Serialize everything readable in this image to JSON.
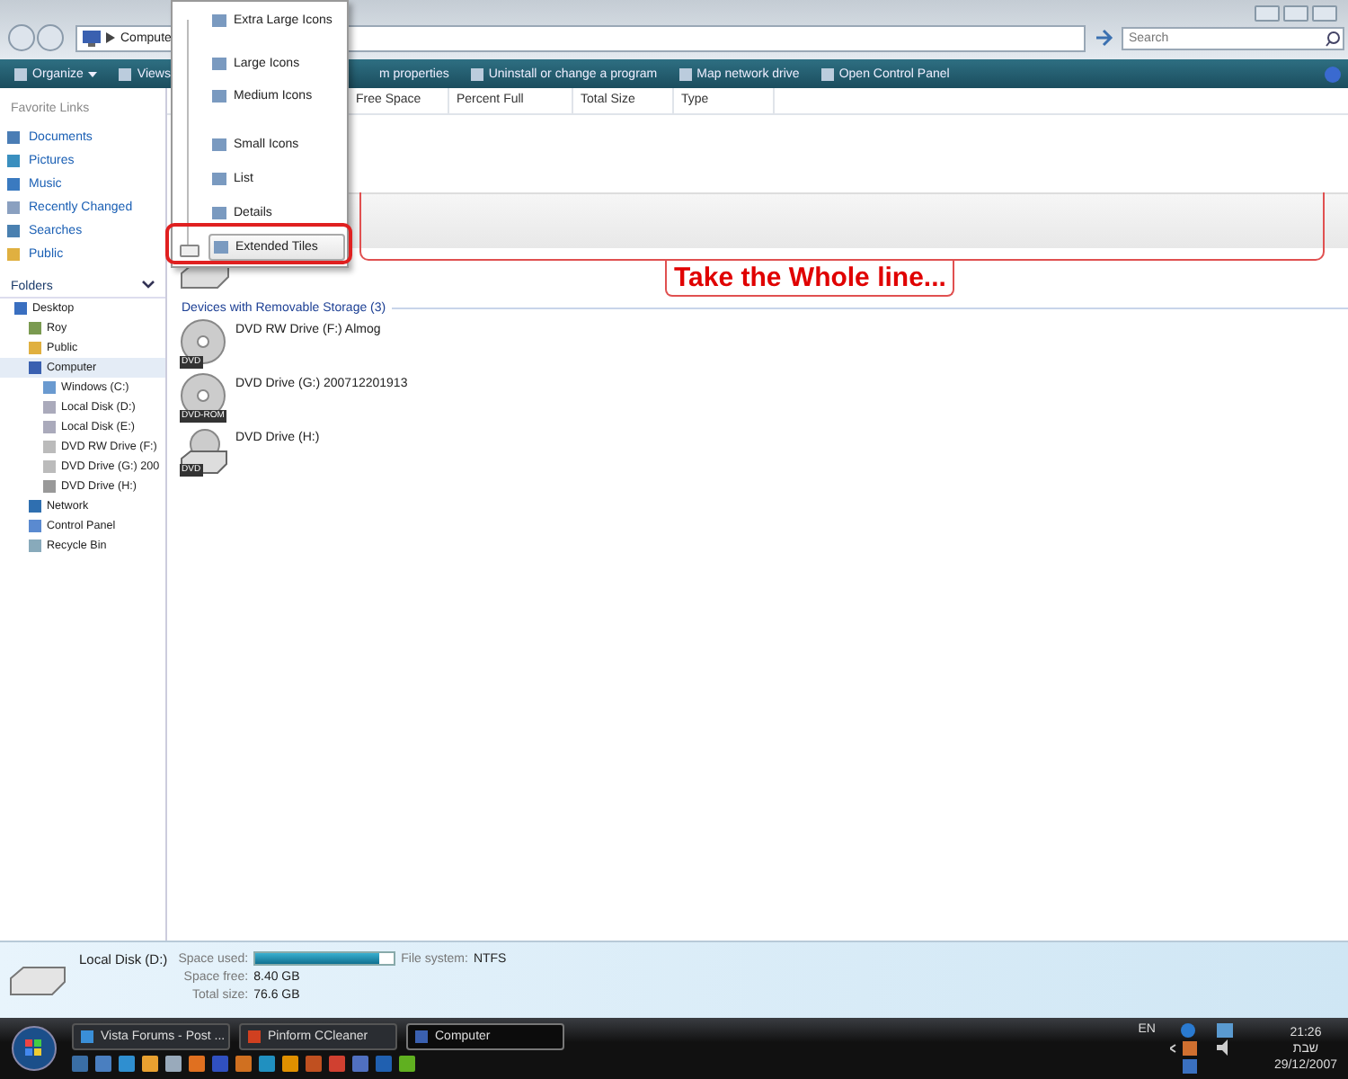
{
  "address_bar": {
    "crumb": "Compute"
  },
  "search": {
    "placeholder": "Search"
  },
  "toolbar": [
    {
      "label": "Organize",
      "kind": "menu"
    },
    {
      "label": "Views",
      "kind": "menu"
    },
    {
      "label": "m properties",
      "kind": "action"
    },
    {
      "label": "Uninstall or change a program",
      "kind": "action"
    },
    {
      "label": "Map network drive",
      "kind": "action"
    },
    {
      "label": "Open Control Panel",
      "kind": "action"
    }
  ],
  "columns": [
    "Free Space",
    "Percent Full",
    "Total Size",
    "Type"
  ],
  "favorite_links": {
    "title": "Favorite Links",
    "items": [
      "Documents",
      "Pictures",
      "Music",
      "Recently Changed",
      "Searches",
      "Public"
    ]
  },
  "folders": {
    "title": "Folders",
    "tree": [
      {
        "label": "Desktop",
        "kind": "desktop",
        "selected": false,
        "children": [
          {
            "label": "Roy",
            "kind": "user",
            "selected": false
          },
          {
            "label": "Public",
            "kind": "folder",
            "selected": false
          },
          {
            "label": "Computer",
            "kind": "computer",
            "selected": true,
            "children": [
              {
                "label": "Windows (C:)",
                "kind": "system-disk",
                "selected": false
              },
              {
                "label": "Local Disk (D:)",
                "kind": "disk",
                "selected": false
              },
              {
                "label": "Local Disk (E:)",
                "kind": "disk",
                "selected": false
              },
              {
                "label": "DVD RW Drive (F:)",
                "kind": "dvd",
                "selected": false
              },
              {
                "label": "DVD Drive (G:) 200",
                "kind": "dvd",
                "selected": false
              },
              {
                "label": "DVD Drive (H:)",
                "kind": "dvd-drive",
                "selected": false
              }
            ]
          },
          {
            "label": "Network",
            "kind": "network",
            "selected": false
          },
          {
            "label": "Control Panel",
            "kind": "control-panel",
            "selected": false
          },
          {
            "label": "Recycle Bin",
            "kind": "recycle",
            "selected": false
          }
        ]
      }
    ]
  },
  "groups": [
    {
      "title": "Devices with Removable Storage (3)",
      "items": [
        {
          "name": "DVD RW Drive (F:) Almog",
          "kind": "dvd",
          "badge": "DVD"
        },
        {
          "name": "DVD Drive (G:) 200712201913",
          "kind": "dvd",
          "badge": "DVD-ROM"
        },
        {
          "name": "DVD Drive (H:)",
          "kind": "dvd-drive",
          "badge": "DVD"
        }
      ]
    }
  ],
  "views_menu": [
    {
      "label": "Extra Large Icons",
      "selected": false
    },
    {
      "label": "Large Icons",
      "selected": false
    },
    {
      "label": "Medium Icons",
      "selected": false
    },
    {
      "label": "Small Icons",
      "selected": false
    },
    {
      "label": "List",
      "selected": false
    },
    {
      "label": "Details",
      "selected": false
    },
    {
      "label": "Extended Tiles",
      "selected": true
    }
  ],
  "annotation": {
    "text": "Take the Whole line..."
  },
  "details_pane": {
    "name": "Local Disk (D:)",
    "fields": [
      {
        "label": "Space used:",
        "kind": "bar",
        "level": 0.9
      },
      {
        "label": "File system:",
        "kind": "text",
        "value": "NTFS"
      },
      {
        "label": "Space free:",
        "kind": "text",
        "value": "8.40 GB"
      },
      {
        "label": "Total size:",
        "kind": "text",
        "value": "76.6 GB"
      }
    ]
  },
  "taskbar": {
    "buttons": [
      {
        "label": "Vista Forums - Post ...",
        "kind": "browser",
        "selected": false
      },
      {
        "label": "Pinform CCleaner",
        "kind": "cleaner",
        "selected": false
      },
      {
        "label": "Computer",
        "kind": "computer",
        "selected": true
      }
    ],
    "language": "EN",
    "time": "21:26",
    "day": "שבת",
    "date": "29/12/2007"
  }
}
